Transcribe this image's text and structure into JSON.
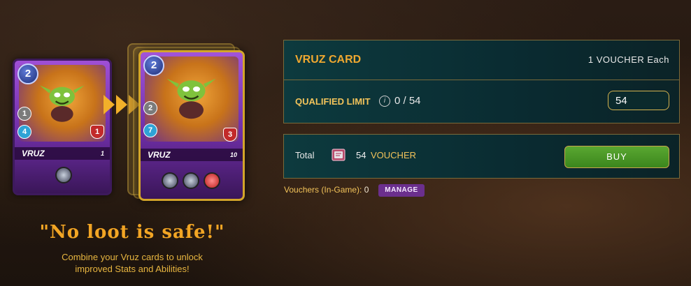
{
  "cards": {
    "before": {
      "name": "VRUZ",
      "mana": "2",
      "attack": "1",
      "speed": "4",
      "health": "1",
      "level": "1"
    },
    "after": {
      "name": "VRUZ",
      "mana": "2",
      "attack": "2",
      "speed": "7",
      "health": "3",
      "level": "10"
    }
  },
  "promo": {
    "motto": "\"No loot is safe!\"",
    "subtitle": "Combine your Vruz cards to unlock improved Stats and Abilities!"
  },
  "purchase": {
    "card_title": "VRUZ CARD",
    "price_each": "1 VOUCHER Each",
    "qualified_limit_label": "QUALIFIED LIMIT",
    "qualified_limit_value": "0 / 54",
    "quantity": "54"
  },
  "total": {
    "label": "Total",
    "amount": "54",
    "currency": "VOUCHER",
    "buy_label": "BUY"
  },
  "vouchers": {
    "label": "Vouchers (In-Game):",
    "count": "0",
    "manage_label": "MANAGE"
  },
  "colors": {
    "accent_gold": "#f0a830",
    "buy_green": "#4a9a27",
    "manage_purple": "#6b2f8d",
    "panel_teal": "#0d3a3e"
  }
}
